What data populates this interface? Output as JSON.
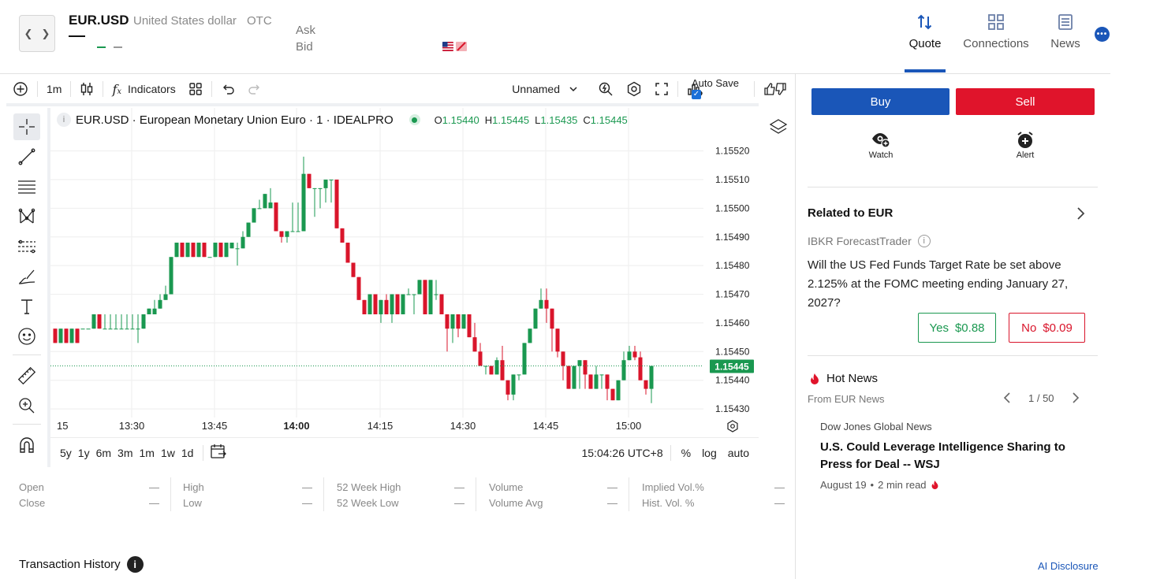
{
  "header": {
    "symbol": "EUR.USD",
    "description": "United States dollar",
    "exchange": "OTC",
    "last_value": "—",
    "ask_label": "Ask",
    "bid_label": "Bid",
    "nav_tabs": [
      {
        "label": "Quote",
        "icon": "sort-arrows-icon",
        "active": true
      },
      {
        "label": "Connections",
        "icon": "grid-squares-icon",
        "active": false
      },
      {
        "label": "News",
        "icon": "newspaper-icon",
        "active": false
      }
    ]
  },
  "toolbar": {
    "interval": "1m",
    "indicators_label": "Indicators",
    "layout_name": "Unnamed",
    "auto_save_label": "Auto Save",
    "auto_save_checked": true
  },
  "chart_legend": {
    "title": "EUR.USD · European Monetary Union Euro · 1 · IDEALPRO",
    "open_key": "O",
    "open": "1.15440",
    "high_key": "H",
    "high": "1.15445",
    "low_key": "L",
    "low": "1.15435",
    "close_key": "C",
    "close": "1.15445"
  },
  "chart_data": {
    "type": "candlestick",
    "x_ticks": [
      "15",
      "13:30",
      "13:45",
      "14:00",
      "14:15",
      "14:30",
      "14:45",
      "15:00"
    ],
    "y_ticks": [
      1.1552,
      1.1551,
      1.155,
      1.1549,
      1.1548,
      1.1547,
      1.1546,
      1.1545,
      1.1544,
      1.1543
    ],
    "y_tick_labels": [
      "1.15520",
      "1.15510",
      "1.15500",
      "1.15490",
      "1.15480",
      "1.15470",
      "1.15460",
      "1.15450",
      "1.15440",
      "1.15430"
    ],
    "ylim": [
      1.15427,
      1.15535
    ],
    "current_price": 1.15445,
    "current_price_label": "1.15445",
    "grid": true,
    "candles": [
      [
        1.15458,
        1.15458,
        1.15453,
        1.15453
      ],
      [
        1.15453,
        1.15458,
        1.15453,
        1.15458
      ],
      [
        1.15458,
        1.15458,
        1.15453,
        1.15453
      ],
      [
        1.15453,
        1.15458,
        1.15453,
        1.15458
      ],
      [
        1.15458,
        1.15458,
        1.15453,
        1.15453
      ],
      [
        1.15458,
        1.15458,
        1.15458,
        1.15458
      ],
      [
        1.15458,
        1.15458,
        1.15458,
        1.15458
      ],
      [
        1.15458,
        1.15463,
        1.15458,
        1.15463
      ],
      [
        1.15463,
        1.15463,
        1.15458,
        1.15458
      ],
      [
        1.15458,
        1.15463,
        1.15458,
        1.15458
      ],
      [
        1.15458,
        1.15463,
        1.15458,
        1.15458
      ],
      [
        1.15458,
        1.15463,
        1.15458,
        1.15458
      ],
      [
        1.15458,
        1.15463,
        1.15458,
        1.15458
      ],
      [
        1.15458,
        1.15463,
        1.15458,
        1.15458
      ],
      [
        1.15458,
        1.15463,
        1.15458,
        1.15458
      ],
      [
        1.15458,
        1.15463,
        1.15453,
        1.15458
      ],
      [
        1.15458,
        1.15463,
        1.15458,
        1.15463
      ],
      [
        1.15463,
        1.15465,
        1.15463,
        1.15465
      ],
      [
        1.15463,
        1.15468,
        1.15463,
        1.15465
      ],
      [
        1.15465,
        1.1547,
        1.15465,
        1.15468
      ],
      [
        1.15468,
        1.15473,
        1.15468,
        1.1547
      ],
      [
        1.1547,
        1.15483,
        1.1547,
        1.15483
      ],
      [
        1.15483,
        1.15488,
        1.15483,
        1.15488
      ],
      [
        1.15488,
        1.15488,
        1.15483,
        1.15483
      ],
      [
        1.15483,
        1.15488,
        1.15483,
        1.15488
      ],
      [
        1.15488,
        1.15488,
        1.15483,
        1.15483
      ],
      [
        1.15483,
        1.15488,
        1.15483,
        1.15488
      ],
      [
        1.15488,
        1.15488,
        1.15483,
        1.15483
      ],
      [
        1.15483,
        1.15483,
        1.15483,
        1.15483
      ],
      [
        1.15483,
        1.15488,
        1.15483,
        1.15488
      ],
      [
        1.15488,
        1.15488,
        1.15483,
        1.15483
      ],
      [
        1.15483,
        1.15488,
        1.15483,
        1.15488
      ],
      [
        1.15486,
        1.15488,
        1.15486,
        1.15488
      ],
      [
        1.15486,
        1.15488,
        1.1548,
        1.15486
      ],
      [
        1.15486,
        1.15492,
        1.15486,
        1.1549
      ],
      [
        1.1549,
        1.15495,
        1.1549,
        1.15495
      ],
      [
        1.15495,
        1.155,
        1.15495,
        1.155
      ],
      [
        1.155,
        1.15503,
        1.155,
        1.155
      ],
      [
        1.155,
        1.15505,
        1.155,
        1.15505
      ],
      [
        1.155,
        1.15507,
        1.155,
        1.15502
      ],
      [
        1.15502,
        1.15502,
        1.15492,
        1.15492
      ],
      [
        1.15492,
        1.15492,
        1.15488,
        1.1549
      ],
      [
        1.1549,
        1.15492,
        1.15488,
        1.15492
      ],
      [
        1.15492,
        1.15502,
        1.15492,
        1.15492
      ],
      [
        1.15492,
        1.15502,
        1.15492,
        1.15492
      ],
      [
        1.15492,
        1.15518,
        1.15492,
        1.15512
      ],
      [
        1.15512,
        1.15512,
        1.15507,
        1.15507
      ],
      [
        1.15507,
        1.15507,
        1.15497,
        1.15507
      ],
      [
        1.15507,
        1.15507,
        1.155,
        1.15507
      ],
      [
        1.15507,
        1.15507,
        1.15502,
        1.1551
      ],
      [
        1.1551,
        1.1551,
        1.15502,
        1.1551
      ],
      [
        1.1551,
        1.1551,
        1.15493,
        1.15493
      ],
      [
        1.15493,
        1.15493,
        1.15488,
        1.15488
      ],
      [
        1.15488,
        1.15488,
        1.15481,
        1.15481
      ],
      [
        1.15481,
        1.15481,
        1.15476,
        1.15476
      ],
      [
        1.15476,
        1.15476,
        1.15468,
        1.15468
      ],
      [
        1.15468,
        1.15468,
        1.15463,
        1.15463
      ],
      [
        1.15463,
        1.1547,
        1.15463,
        1.1547
      ],
      [
        1.1547,
        1.1547,
        1.15463,
        1.15463
      ],
      [
        1.15463,
        1.15468,
        1.1546,
        1.15468
      ],
      [
        1.15468,
        1.1547,
        1.15463,
        1.15463
      ],
      [
        1.15463,
        1.1547,
        1.1546,
        1.1547
      ],
      [
        1.1547,
        1.1547,
        1.15463,
        1.15463
      ],
      [
        1.15463,
        1.1547,
        1.15463,
        1.1547
      ],
      [
        1.1547,
        1.15472,
        1.1547,
        1.1547
      ],
      [
        1.1547,
        1.1547,
        1.15463,
        1.1547
      ],
      [
        1.1547,
        1.15475,
        1.1547,
        1.15475
      ],
      [
        1.15475,
        1.15475,
        1.15463,
        1.15463
      ],
      [
        1.15463,
        1.15475,
        1.15463,
        1.15475
      ],
      [
        1.1547,
        1.15475,
        1.15468,
        1.1547
      ],
      [
        1.1547,
        1.1547,
        1.15463,
        1.15463
      ],
      [
        1.15463,
        1.15463,
        1.1545,
        1.15458
      ],
      [
        1.15458,
        1.15463,
        1.15453,
        1.15463
      ],
      [
        1.15463,
        1.15463,
        1.15455,
        1.15458
      ],
      [
        1.15458,
        1.15463,
        1.15458,
        1.15463
      ],
      [
        1.15463,
        1.15463,
        1.15455,
        1.15455
      ],
      [
        1.15455,
        1.1546,
        1.1545,
        1.1545
      ],
      [
        1.1545,
        1.15453,
        1.15445,
        1.15445
      ],
      [
        1.15445,
        1.15445,
        1.15442,
        1.15445
      ],
      [
        1.15445,
        1.15445,
        1.15442,
        1.15442
      ],
      [
        1.15442,
        1.15448,
        1.15442,
        1.15447
      ],
      [
        1.15447,
        1.15452,
        1.1544,
        1.1544
      ],
      [
        1.1544,
        1.1544,
        1.15433,
        1.15435
      ],
      [
        1.15435,
        1.15442,
        1.15433,
        1.15442
      ],
      [
        1.15442,
        1.15442,
        1.1544,
        1.15442
      ],
      [
        1.15442,
        1.15453,
        1.15442,
        1.15453
      ],
      [
        1.15453,
        1.15458,
        1.15453,
        1.15458
      ],
      [
        1.15458,
        1.15465,
        1.15458,
        1.15465
      ],
      [
        1.15465,
        1.15472,
        1.15465,
        1.15468
      ],
      [
        1.15468,
        1.15472,
        1.1546,
        1.15465
      ],
      [
        1.15465,
        1.15465,
        1.1545,
        1.15458
      ],
      [
        1.15458,
        1.15458,
        1.15448,
        1.1545
      ],
      [
        1.1545,
        1.1545,
        1.1544,
        1.15445
      ],
      [
        1.15445,
        1.15445,
        1.15437,
        1.15437
      ],
      [
        1.15437,
        1.15445,
        1.15437,
        1.15445
      ],
      [
        1.15445,
        1.15447,
        1.15437,
        1.15447
      ],
      [
        1.15447,
        1.15447,
        1.15437,
        1.15442
      ],
      [
        1.15442,
        1.15442,
        1.15437,
        1.15437
      ],
      [
        1.15437,
        1.15445,
        1.15437,
        1.15442
      ],
      [
        1.15442,
        1.15442,
        1.15437,
        1.15442
      ],
      [
        1.15442,
        1.15442,
        1.15433,
        1.15437
      ],
      [
        1.15437,
        1.15437,
        1.15433,
        1.15433
      ],
      [
        1.15433,
        1.1544,
        1.15433,
        1.1544
      ],
      [
        1.1544,
        1.1545,
        1.1544,
        1.15447
      ],
      [
        1.15447,
        1.15452,
        1.15447,
        1.1545
      ],
      [
        1.1545,
        1.15452,
        1.15447,
        1.15448
      ],
      [
        1.15448,
        1.1545,
        1.1544,
        1.1544
      ],
      [
        1.1544,
        1.1544,
        1.15435,
        1.15437
      ],
      [
        1.15437,
        1.15445,
        1.15432,
        1.15445
      ]
    ]
  },
  "time_row": {
    "ranges": [
      "5y",
      "1y",
      "6m",
      "3m",
      "1m",
      "1w",
      "1d"
    ],
    "clock": "15:04:26 UTC+8",
    "pct": "%",
    "log": "log",
    "auto": "auto"
  },
  "stats": [
    {
      "label": "Open",
      "value": "—"
    },
    {
      "label": "Close",
      "value": "—"
    },
    {
      "label": "High",
      "value": "—"
    },
    {
      "label": "Low",
      "value": "—"
    },
    {
      "label": "52 Week High",
      "value": "—"
    },
    {
      "label": "52 Week Low",
      "value": "—"
    },
    {
      "label": "Volume",
      "value": "—"
    },
    {
      "label": "Volume Avg",
      "value": "—"
    },
    {
      "label": "Implied Vol.%",
      "value": "—"
    },
    {
      "label": "Hist. Vol. %",
      "value": "—"
    }
  ],
  "transaction_history": {
    "label": "Transaction History",
    "info": "i"
  },
  "trade": {
    "buy_label": "Buy",
    "sell_label": "Sell",
    "watch_label": "Watch",
    "alert_label": "Alert"
  },
  "related": {
    "title": "Related to EUR",
    "source": "IBKR ForecastTrader",
    "info": "i",
    "question": "Will the US Fed Funds Target Rate be set above 2.125% at the FOMC meeting ending January 27, 2027?",
    "yes_label": "Yes",
    "yes_price": "$0.88",
    "no_label": "No",
    "no_price": "$0.09"
  },
  "hot_news": {
    "title": "Hot News",
    "from": "From EUR News",
    "pager": "1 / 50",
    "source": "Dow Jones Global News",
    "headline": "U.S. Could Leverage Intelligence Sharing to Press for Deal -- WSJ",
    "date": "August 19",
    "read_time": "2 min read"
  },
  "footer": {
    "ai_disclosure": "AI Disclosure"
  },
  "colors": {
    "up": "#1a9850",
    "down": "#d9152b",
    "brand": "#1a56b8",
    "sell": "#e0142b"
  }
}
